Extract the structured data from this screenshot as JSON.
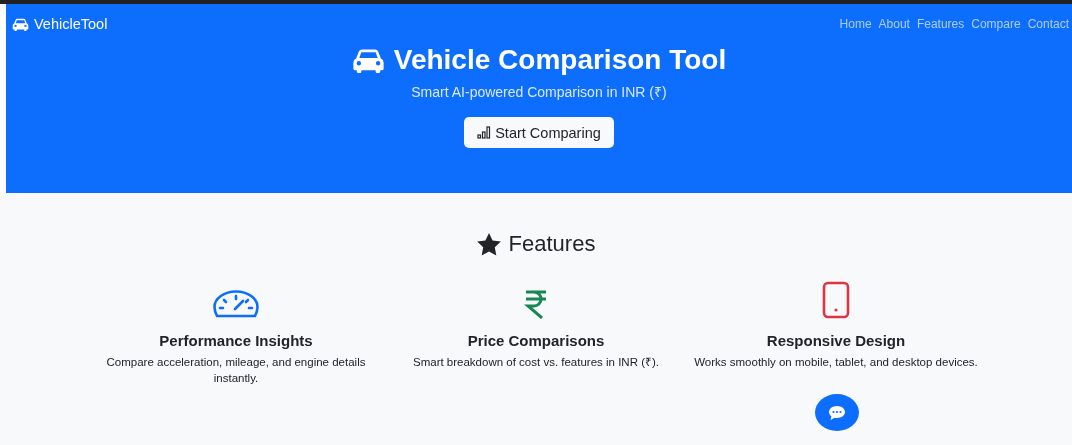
{
  "navbar": {
    "brand": "VehicleTool",
    "links": [
      "Home",
      "About",
      "Features",
      "Compare",
      "Contact"
    ]
  },
  "hero": {
    "title": "Vehicle Comparison Tool",
    "subtitle": "Smart AI-powered Comparison in INR (₹)",
    "button": "Start Comparing"
  },
  "features": {
    "heading": "Features",
    "items": [
      {
        "title": "Performance Insights",
        "description": "Compare acceleration, mileage, and engine details instantly.",
        "color": "#0d6efd"
      },
      {
        "title": "Price Comparisons",
        "description": "Smart breakdown of cost vs. features in INR (₹).",
        "color": "#198754"
      },
      {
        "title": "Responsive Design",
        "description": "Works smoothly on mobile, tablet, and desktop devices.",
        "color": "#dc3545"
      }
    ]
  }
}
